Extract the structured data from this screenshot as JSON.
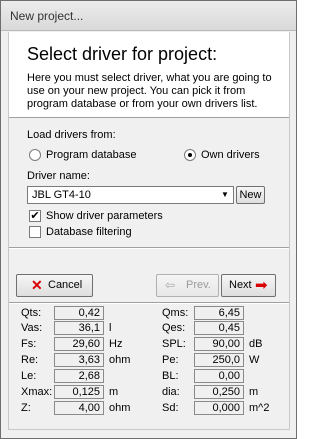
{
  "window": {
    "title": "New project..."
  },
  "header": {
    "title": "Select driver for project:",
    "description": "Here you must select driver, what you are going to use on your new project. You can pick it from program database or from your own drivers list."
  },
  "source": {
    "label": "Load drivers from:",
    "options": [
      {
        "label": "Program database",
        "checked": false
      },
      {
        "label": "Own drivers",
        "checked": true
      }
    ]
  },
  "driver": {
    "label": "Driver name:",
    "value": "JBL GT4-10",
    "new_button": "New"
  },
  "options": {
    "show_params": {
      "label": "Show driver parameters",
      "checked": true
    },
    "db_filtering": {
      "label": "Database filtering",
      "checked": false
    }
  },
  "buttons": {
    "cancel": "Cancel",
    "prev": "Prev.",
    "next": "Next"
  },
  "params_left": [
    {
      "label": "Qts:",
      "value": "0,42",
      "unit": ""
    },
    {
      "label": "Vas:",
      "value": "36,1",
      "unit": "l"
    },
    {
      "label": "Fs:",
      "value": "29,60",
      "unit": "Hz"
    },
    {
      "label": "Re:",
      "value": "3,63",
      "unit": "ohm"
    },
    {
      "label": "Le:",
      "value": "2,68",
      "unit": ""
    },
    {
      "label": "Xmax:",
      "value": "0,125",
      "unit": "m"
    },
    {
      "label": "Z:",
      "value": "4,00",
      "unit": "ohm"
    }
  ],
  "params_right": [
    {
      "label": "Qms:",
      "value": "6,45",
      "unit": ""
    },
    {
      "label": "Qes:",
      "value": "0,45",
      "unit": ""
    },
    {
      "label": "SPL:",
      "value": "90,00",
      "unit": "dB"
    },
    {
      "label": "Pe:",
      "value": "250,0",
      "unit": "W"
    },
    {
      "label": "BL:",
      "value": "0,00",
      "unit": ""
    },
    {
      "label": "dia:",
      "value": "0,250",
      "unit": "m"
    },
    {
      "label": "Sd:",
      "value": "0,000",
      "unit": "m^2"
    }
  ]
}
